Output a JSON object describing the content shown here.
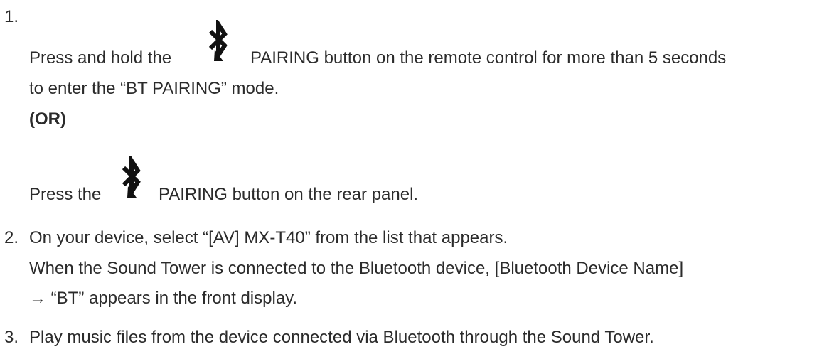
{
  "steps": [
    {
      "number": "1.",
      "part_a_before": "Press and hold the",
      "part_a_after": "PAIRING button on the remote control for more than 5 seconds",
      "part_a_cont": "to enter the “BT PAIRING” mode.",
      "or_label": "(OR)",
      "part_b_before": "Press the",
      "part_b_after": "PAIRING button on the rear panel."
    },
    {
      "number": "2.",
      "text": "On your device, select “[AV] MX-T40” from the list that appears.",
      "note_line1": "When the Sound Tower is connected to the Bluetooth device, [Bluetooth Device Name]",
      "note_line2": "→ “BT” appears in the front display."
    },
    {
      "number": "3.",
      "text": "Play music files from the device connected via Bluetooth through the Sound Tower."
    }
  ],
  "icons": {
    "pairing": "bluetooth-icon"
  },
  "colors": {
    "text": "#2b2b2b",
    "icon": "#111111"
  }
}
